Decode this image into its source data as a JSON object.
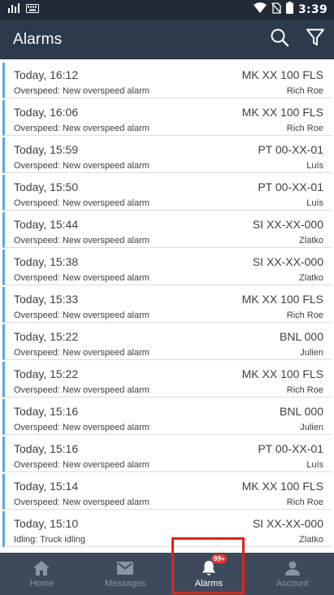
{
  "status_bar": {
    "time": "3:39",
    "icons": [
      "signal-icon",
      "keyboard-icon",
      "wifi-icon",
      "no-sim-icon",
      "battery-icon"
    ]
  },
  "app_bar": {
    "title": "Alarms",
    "actions": [
      "search-icon",
      "filter-icon"
    ]
  },
  "alarms": [
    {
      "time": "Today, 16:12",
      "plate": "MK XX 100 FLS",
      "description": "Overspeed: New overspeed alarm",
      "driver": "Rich Roe"
    },
    {
      "time": "Today, 16:06",
      "plate": "MK XX 100 FLS",
      "description": "Overspeed: New overspeed alarm",
      "driver": "Rich Roe"
    },
    {
      "time": "Today, 15:59",
      "plate": "PT 00-XX-01",
      "description": "Overspeed: New overspeed alarm",
      "driver": "Luís"
    },
    {
      "time": "Today, 15:50",
      "plate": "PT 00-XX-01",
      "description": "Overspeed: New overspeed alarm",
      "driver": "Luís"
    },
    {
      "time": "Today, 15:44",
      "plate": "SI XX-XX-000",
      "description": "Overspeed: New overspeed alarm",
      "driver": "Zlatko"
    },
    {
      "time": "Today, 15:38",
      "plate": "SI XX-XX-000",
      "description": "Overspeed: New overspeed alarm",
      "driver": "Zlatko"
    },
    {
      "time": "Today, 15:33",
      "plate": "MK XX 100 FLS",
      "description": "Overspeed: New overspeed alarm",
      "driver": "Rich Roe"
    },
    {
      "time": "Today, 15:22",
      "plate": "BNL 000",
      "description": "Overspeed: New overspeed alarm",
      "driver": "Julien"
    },
    {
      "time": "Today, 15:22",
      "plate": "MK XX 100 FLS",
      "description": "Overspeed: New overspeed alarm",
      "driver": "Rich Roe"
    },
    {
      "time": "Today, 15:16",
      "plate": "BNL 000",
      "description": "Overspeed: New overspeed alarm",
      "driver": "Julien"
    },
    {
      "time": "Today, 15:16",
      "plate": "PT 00-XX-01",
      "description": "Overspeed: New overspeed alarm",
      "driver": "Luís"
    },
    {
      "time": "Today, 15:14",
      "plate": "MK XX 100 FLS",
      "description": "Overspeed: New overspeed alarm",
      "driver": "Rich Roe"
    },
    {
      "time": "Today, 15:10",
      "plate": "SI XX-XX-000",
      "description": "Idling: Truck idling",
      "driver": "Zlatko"
    }
  ],
  "bottom_nav": {
    "items": [
      {
        "label": "Home",
        "icon": "home-icon",
        "active": false
      },
      {
        "label": "Messages",
        "icon": "mail-icon",
        "active": false
      },
      {
        "label": "Alarms",
        "icon": "bell-icon",
        "active": true,
        "badge": "99+"
      },
      {
        "label": "Account",
        "icon": "person-icon",
        "active": false
      }
    ]
  },
  "colors": {
    "status_bar_bg": "#212b38",
    "app_bar_bg": "#2d3a4b",
    "nav_bg": "#3e4a5b",
    "accent_bar": "#5aa9dd",
    "badge": "#e53935",
    "highlight": "#e1251b"
  }
}
